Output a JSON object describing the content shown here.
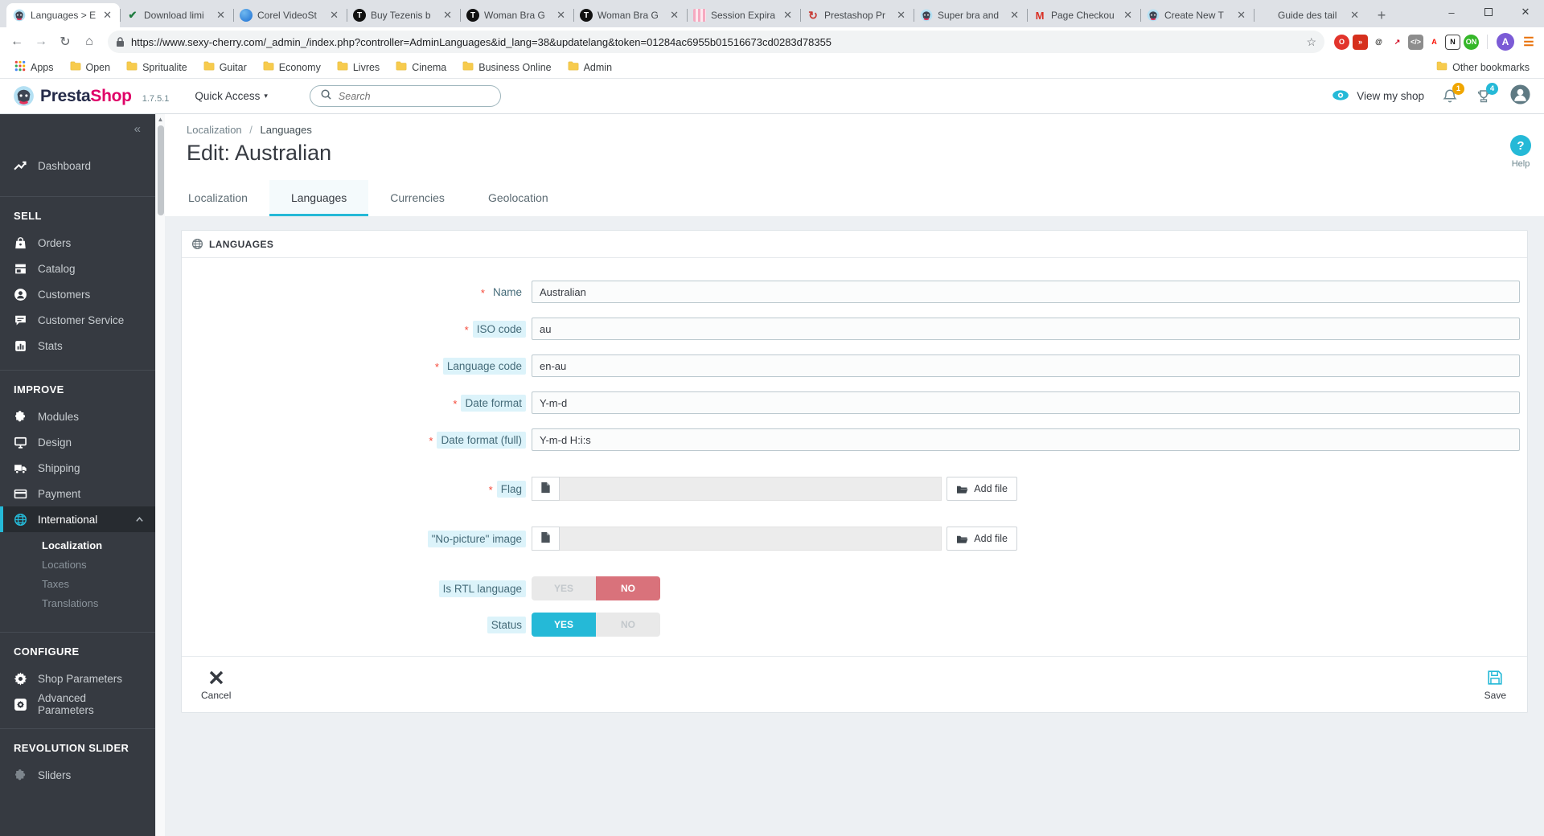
{
  "colors": {
    "accent": "#25b9d7",
    "danger_toggle": "#d9727b",
    "sidebar_bg": "#363a41",
    "brand_pink": "#df0067",
    "badge_orange": "#f0a600"
  },
  "browser": {
    "tabs": [
      {
        "title": "Languages > E",
        "favicon": "prestashop-favicon",
        "active": true
      },
      {
        "title": "Download limi",
        "favicon": "green-check-favicon"
      },
      {
        "title": "Corel VideoSt",
        "favicon": "blue-balloon-favicon"
      },
      {
        "title": "Buy Tezenis b",
        "favicon": "black-t-favicon"
      },
      {
        "title": "Woman Bra G",
        "favicon": "black-t-favicon"
      },
      {
        "title": "Woman Bra G",
        "favicon": "black-t-favicon"
      },
      {
        "title": "Session Expira",
        "favicon": "pink-stripes-favicon"
      },
      {
        "title": "Prestashop Pr",
        "favicon": "red-swirl-favicon"
      },
      {
        "title": "Super bra and",
        "favicon": "prestashop-favicon"
      },
      {
        "title": "Page Checkou",
        "favicon": "gmail-favicon"
      },
      {
        "title": "Create New T",
        "favicon": "prestashop-favicon"
      },
      {
        "title": "Guide des tail",
        "favicon": "blank-favicon"
      }
    ],
    "new_tab_label": "+",
    "url": "https://www.sexy-cherry.com/_admin_/index.php?controller=AdminLanguages&id_lang=38&updatelang&token=01284ac6955b01516673cd0283d78355",
    "bookmarks": [
      "Apps",
      "Open",
      "Spritualite",
      "Guitar",
      "Economy",
      "Livres",
      "Cinema",
      "Business Online",
      "Admin"
    ],
    "other_bookmarks": "Other bookmarks",
    "extensions": [
      {
        "name": "adblock-icon",
        "glyph": "O",
        "fg": "#ffffff",
        "bg": "#e2342c",
        "round": true
      },
      {
        "name": "fast-forward-icon",
        "glyph": "»",
        "fg": "#ffffff",
        "bg": "#d6301d"
      },
      {
        "name": "swirl-icon",
        "glyph": "@",
        "fg": "#1d1d1b",
        "bg": "#ffffff"
      },
      {
        "name": "red-arrow-icon",
        "glyph": "↗",
        "fg": "#d0021b",
        "bg": "#ffffff"
      },
      {
        "name": "code-icon",
        "glyph": "</>",
        "fg": "#ffffff",
        "bg": "#8d8d8d"
      },
      {
        "name": "acrobat-icon",
        "glyph": "A",
        "fg": "#fa0f00",
        "bg": "#ffffff"
      },
      {
        "name": "notion-icon",
        "glyph": "N",
        "fg": "#111111",
        "bg": "#ffffff"
      },
      {
        "name": "on-icon",
        "glyph": "ON",
        "fg": "#ffffff",
        "bg": "#35b729",
        "round": true
      }
    ],
    "profile_initial": "A"
  },
  "ps_header": {
    "brand_presta": "Presta",
    "brand_shop": "Shop",
    "version": "1.7.5.1",
    "quick_access": "Quick Access",
    "search_placeholder": "Search",
    "view_shop": "View my shop",
    "bell_badge": "1",
    "trophy_badge": "4"
  },
  "sidebar": {
    "collapse": "«",
    "dashboard": {
      "label": "Dashboard"
    },
    "sections": [
      {
        "header": "SELL",
        "items": [
          {
            "label": "Orders",
            "icon": "bag-icon"
          },
          {
            "label": "Catalog",
            "icon": "store-icon"
          },
          {
            "label": "Customers",
            "icon": "person-icon"
          },
          {
            "label": "Customer Service",
            "icon": "chat-icon"
          },
          {
            "label": "Stats",
            "icon": "chart-icon"
          }
        ]
      },
      {
        "header": "IMPROVE",
        "items": [
          {
            "label": "Modules",
            "icon": "puzzle-icon"
          },
          {
            "label": "Design",
            "icon": "monitor-icon"
          },
          {
            "label": "Shipping",
            "icon": "truck-icon"
          },
          {
            "label": "Payment",
            "icon": "card-icon"
          },
          {
            "label": "International",
            "icon": "globe-icon",
            "active": true,
            "submenu": [
              {
                "label": "Localization",
                "active": true
              },
              {
                "label": "Locations"
              },
              {
                "label": "Taxes"
              },
              {
                "label": "Translations"
              }
            ]
          }
        ]
      },
      {
        "header": "CONFIGURE",
        "items": [
          {
            "label": "Shop Parameters",
            "icon": "gear-icon"
          },
          {
            "label": "Advanced Parameters",
            "icon": "gear-box-icon"
          }
        ]
      },
      {
        "header": "REVOLUTION SLIDER",
        "items": [
          {
            "label": "Sliders",
            "icon": "puzzle-gray-icon"
          }
        ]
      }
    ]
  },
  "page": {
    "breadcrumb": [
      "Localization",
      "Languages"
    ],
    "breadcrumb_sep": "/",
    "title": "Edit: Australian",
    "help_label": "Help",
    "help_glyph": "?",
    "tabs": [
      {
        "label": "Localization"
      },
      {
        "label": "Languages",
        "active": true
      },
      {
        "label": "Currencies"
      },
      {
        "label": "Geolocation"
      }
    ]
  },
  "panel": {
    "header": "LANGUAGES",
    "required_marker": "*",
    "fields": [
      {
        "id": "name",
        "label": "Name",
        "required": true,
        "help": false,
        "type": "text",
        "value": "Australian"
      },
      {
        "id": "iso-code",
        "label": "ISO code",
        "required": true,
        "help": true,
        "type": "text",
        "value": "au"
      },
      {
        "id": "language-code",
        "label": "Language code",
        "required": true,
        "help": true,
        "type": "text",
        "value": "en-au"
      },
      {
        "id": "date-format",
        "label": "Date format",
        "required": true,
        "help": true,
        "type": "text",
        "value": "Y-m-d"
      },
      {
        "id": "date-format-full",
        "label": "Date format (full)",
        "required": true,
        "help": true,
        "type": "text",
        "value": "Y-m-d H:i:s"
      },
      {
        "id": "flag",
        "label": "Flag",
        "required": true,
        "help": true,
        "type": "file",
        "value": "",
        "add_file_label": "Add file"
      },
      {
        "id": "no-picture-image",
        "label": "\"No-picture\" image",
        "required": false,
        "help": true,
        "type": "file",
        "value": "",
        "add_file_label": "Add file"
      },
      {
        "id": "is-rtl",
        "label": "Is RTL language",
        "required": false,
        "help": true,
        "type": "toggle",
        "yes": "YES",
        "no": "NO",
        "active": "no"
      },
      {
        "id": "status",
        "label": "Status",
        "required": false,
        "help": true,
        "type": "toggle",
        "yes": "YES",
        "no": "NO",
        "active": "yes"
      }
    ],
    "cancel_label": "Cancel",
    "save_label": "Save"
  }
}
